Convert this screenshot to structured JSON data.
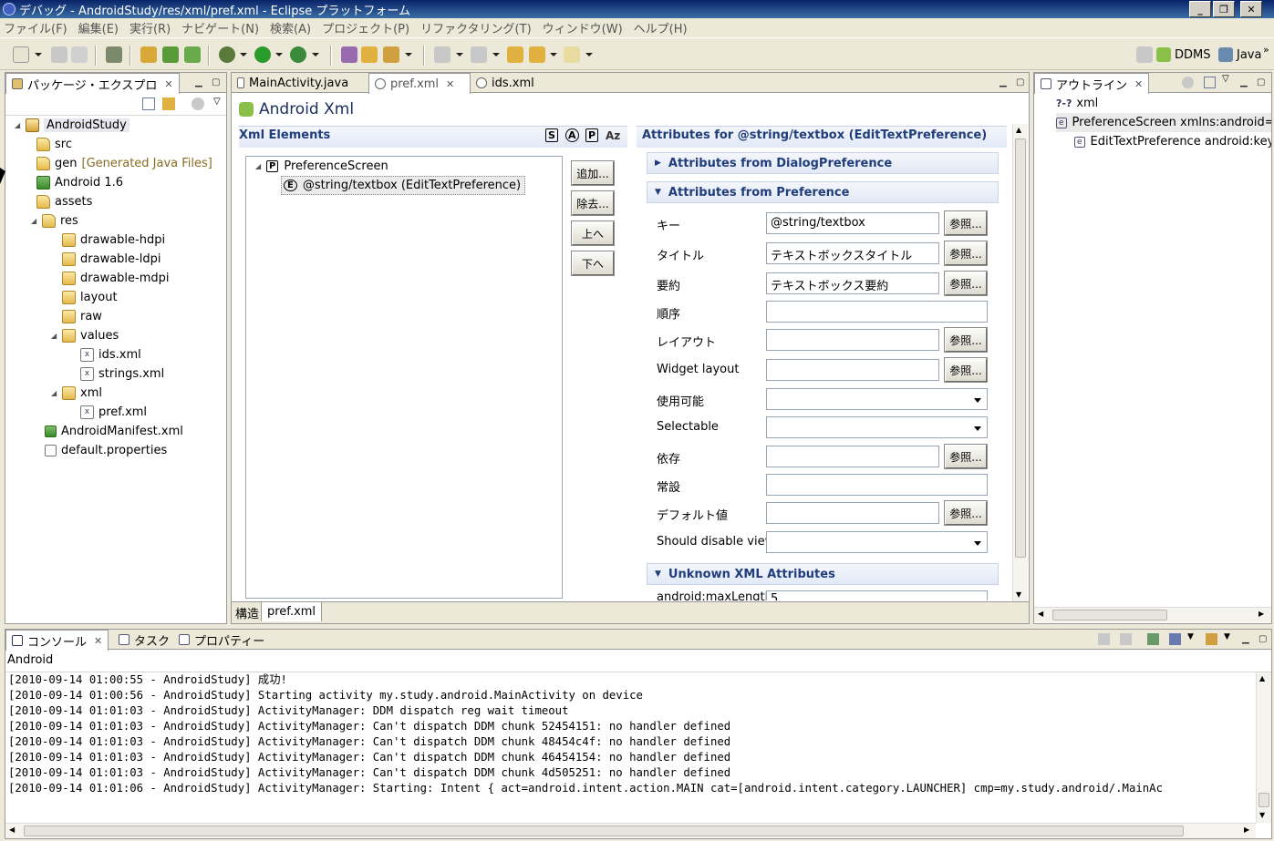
{
  "window": {
    "title": "デバッグ - AndroidStudy/res/xml/pref.xml - Eclipse プラットフォーム"
  },
  "menu": [
    "ファイル(F)",
    "編集(E)",
    "実行(R)",
    "ナビゲート(N)",
    "検索(A)",
    "プロジェクト(P)",
    "リファクタリング(T)",
    "ウィンドウ(W)",
    "ヘルプ(H)"
  ],
  "perspectives": {
    "ddms": "DDMS",
    "java": "Java"
  },
  "package_explorer": {
    "tab_label": "パッケージ・エクスプロ",
    "tree": [
      {
        "label": "AndroidStudy"
      },
      {
        "label": "src"
      },
      {
        "label": "gen",
        "decoration": "[Generated Java Files]"
      },
      {
        "label": "Android 1.6"
      },
      {
        "label": "assets"
      },
      {
        "label": "res"
      },
      {
        "label": "drawable-hdpi"
      },
      {
        "label": "drawable-ldpi"
      },
      {
        "label": "drawable-mdpi"
      },
      {
        "label": "layout"
      },
      {
        "label": "raw"
      },
      {
        "label": "values"
      },
      {
        "label": "ids.xml"
      },
      {
        "label": "strings.xml"
      },
      {
        "label": "xml"
      },
      {
        "label": "pref.xml"
      },
      {
        "label": "AndroidManifest.xml"
      },
      {
        "label": "default.properties"
      }
    ]
  },
  "editor": {
    "tabs": [
      "MainActivity.java",
      "pref.xml",
      "ids.xml"
    ],
    "form_title": "Android Xml",
    "xml_elements_header": "Xml Elements",
    "toolbar_letters": [
      "S",
      "A",
      "P",
      "Az"
    ],
    "tree": {
      "root_icon": "P",
      "root": "PreferenceScreen",
      "child_icon": "E",
      "child": "@string/textbox (EditTextPreference)"
    },
    "side_buttons": [
      "追加...",
      "除去...",
      "上へ",
      "下へ"
    ],
    "attributes_header": "Attributes for @string/textbox (EditTextPreference)",
    "sections": {
      "dialog": "Attributes from DialogPreference",
      "preference": "Attributes from Preference",
      "unknown": "Unknown XML Attributes"
    },
    "browse_label": "参照...",
    "fields": [
      {
        "label": "キー",
        "value": "@string/textbox"
      },
      {
        "label": "タイトル",
        "value": "テキストボックスタイトル"
      },
      {
        "label": "要約",
        "value": "テキストボックス要約"
      },
      {
        "label": "順序",
        "value": ""
      },
      {
        "label": "レイアウト",
        "value": ""
      },
      {
        "label": "Widget layout",
        "value": ""
      },
      {
        "label": "使用可能",
        "value": ""
      },
      {
        "label": "Selectable",
        "value": ""
      },
      {
        "label": "依存",
        "value": ""
      },
      {
        "label": "常設",
        "value": ""
      },
      {
        "label": "デフォルト値",
        "value": ""
      },
      {
        "label": "Should disable view",
        "value": ""
      }
    ],
    "unknown_field": {
      "label": "android:maxLength",
      "value": "5"
    },
    "bottom_tabs": [
      "構造",
      "pref.xml"
    ]
  },
  "outline": {
    "tab_label": "アウトライン",
    "items": [
      {
        "icon": "?-?",
        "label": "xml"
      },
      {
        "icon": "e",
        "label": "PreferenceScreen xmlns:android=htt"
      },
      {
        "icon": "e",
        "label": "EditTextPreference android:key=("
      }
    ]
  },
  "bottom": {
    "tabs": [
      "コンソール",
      "タスク",
      "プロパティー"
    ],
    "console_name": "Android",
    "lines": [
      "[2010-09-14 01:00:55 - AndroidStudy] 成功!",
      "[2010-09-14 01:00:56 - AndroidStudy] Starting activity my.study.android.MainActivity on device",
      "[2010-09-14 01:01:03 - AndroidStudy] ActivityManager: DDM dispatch reg wait timeout",
      "[2010-09-14 01:01:03 - AndroidStudy] ActivityManager: Can't dispatch DDM chunk 52454151: no handler defined",
      "[2010-09-14 01:01:03 - AndroidStudy] ActivityManager: Can't dispatch DDM chunk 48454c4f: no handler defined",
      "[2010-09-14 01:01:03 - AndroidStudy] ActivityManager: Can't dispatch DDM chunk 46454154: no handler defined",
      "[2010-09-14 01:01:03 - AndroidStudy] ActivityManager: Can't dispatch DDM chunk 4d505251: no handler defined",
      "[2010-09-14 01:01:06 - AndroidStudy] ActivityManager: Starting: Intent { act=android.intent.action.MAIN cat=[android.intent.category.LAUNCHER] cmp=my.study.android/.MainAc"
    ]
  },
  "colors": {
    "title_bar": "#0a246a",
    "section_text": "#1f3d7a",
    "decoration": "#8a6a20"
  }
}
